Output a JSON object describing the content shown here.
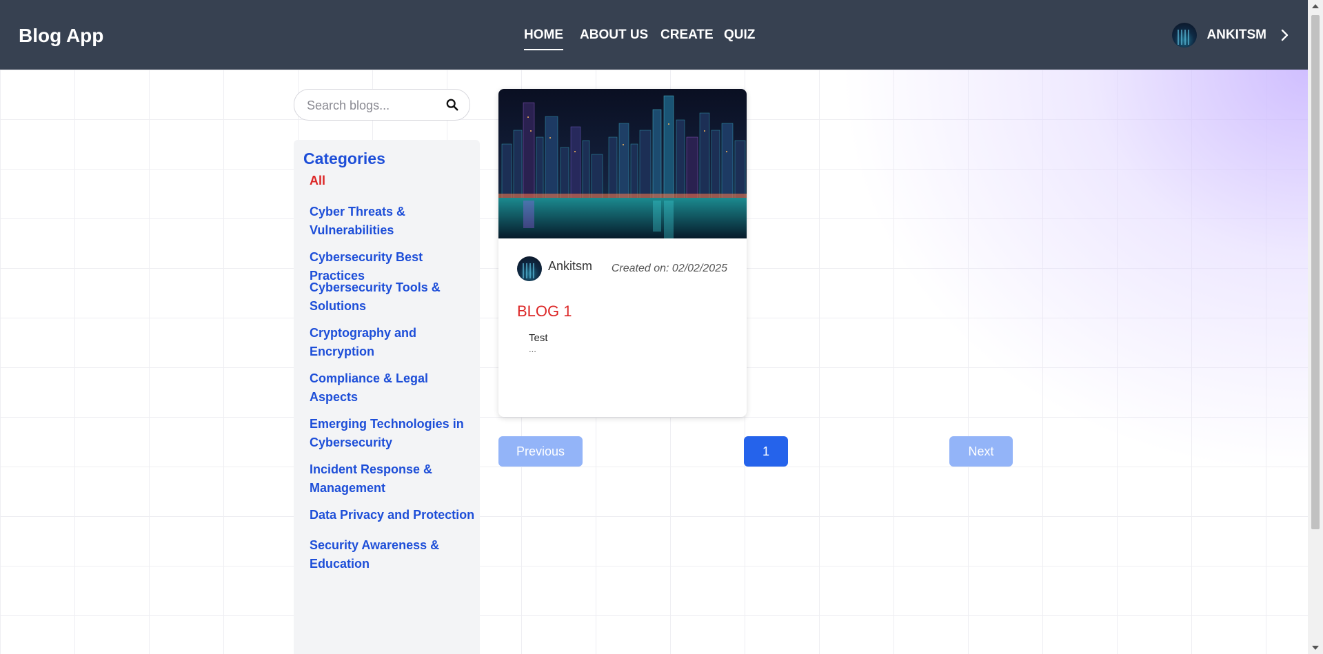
{
  "header": {
    "brand": "Blog App",
    "nav": [
      {
        "label": "HOME",
        "active": true
      },
      {
        "label": "ABOUT US",
        "active": false
      },
      {
        "label": "CREATE",
        "active": false
      },
      {
        "label": "QUIZ",
        "active": false
      }
    ],
    "user": {
      "name": "ANKITSM",
      "avatar_icon": "avatar-icon",
      "chevron_icon": "chevron-right-icon"
    }
  },
  "search": {
    "placeholder": "Search blogs...",
    "value": "",
    "icon": "search-icon"
  },
  "categories": {
    "title": "Categories",
    "items": [
      {
        "label": "All",
        "active": true
      },
      {
        "label": "Cyber Threats & Vulnerabilities",
        "active": false
      },
      {
        "label": "Cybersecurity Best Practices",
        "active": false
      },
      {
        "label": "Cybersecurity Tools & Solutions",
        "active": false
      },
      {
        "label": "Cryptography and Encryption",
        "active": false
      },
      {
        "label": "Compliance & Legal Aspects",
        "active": false
      },
      {
        "label": "Emerging Technologies in Cybersecurity",
        "active": false
      },
      {
        "label": "Incident Response & Management",
        "active": false
      },
      {
        "label": "Data Privacy and Protection",
        "active": false
      },
      {
        "label": "Security Awareness & Education",
        "active": false
      }
    ]
  },
  "blog": {
    "author": "Ankitsm",
    "created": "Created on: 02/02/2025",
    "title": "BLOG 1",
    "excerpt": "Test",
    "ellipsis": "..."
  },
  "pagination": {
    "previous": "Previous",
    "current": "1",
    "next": "Next"
  },
  "colors": {
    "header_bg": "#374151",
    "accent": "#1d4ed8",
    "title_red": "#dc2626",
    "button": "#2563eb",
    "button_disabled": "#93b4f8"
  }
}
